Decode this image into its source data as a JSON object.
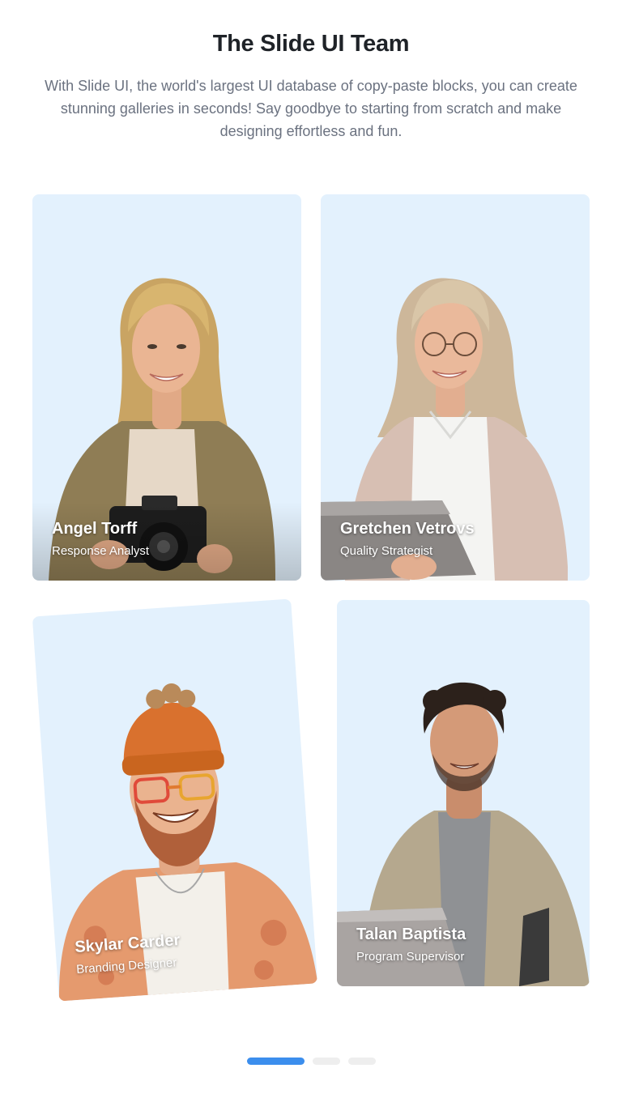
{
  "header": {
    "title": "The Slide UI Team",
    "subtitle": "With Slide UI, the world's largest UI database of copy-paste blocks, you can create stunning galleries in seconds! Say goodbye to starting from scratch and make designing effortless and fun."
  },
  "team": [
    {
      "name": "Angel Torff",
      "role": "Response Analyst"
    },
    {
      "name": "Gretchen Vetrovs",
      "role": "Quality Strategist"
    },
    {
      "name": "Skylar Carder",
      "role": "Branding Designer"
    },
    {
      "name": "Talan Baptista",
      "role": "Program Supervisor"
    }
  ],
  "pagination": {
    "pages": 3,
    "active_index": 0
  },
  "colors": {
    "card_background": "#e3f1fd",
    "title": "#1f2328",
    "subtitle": "#6b7280",
    "pager_active": "#3b8eed",
    "pager_inactive": "#eeeeee"
  }
}
